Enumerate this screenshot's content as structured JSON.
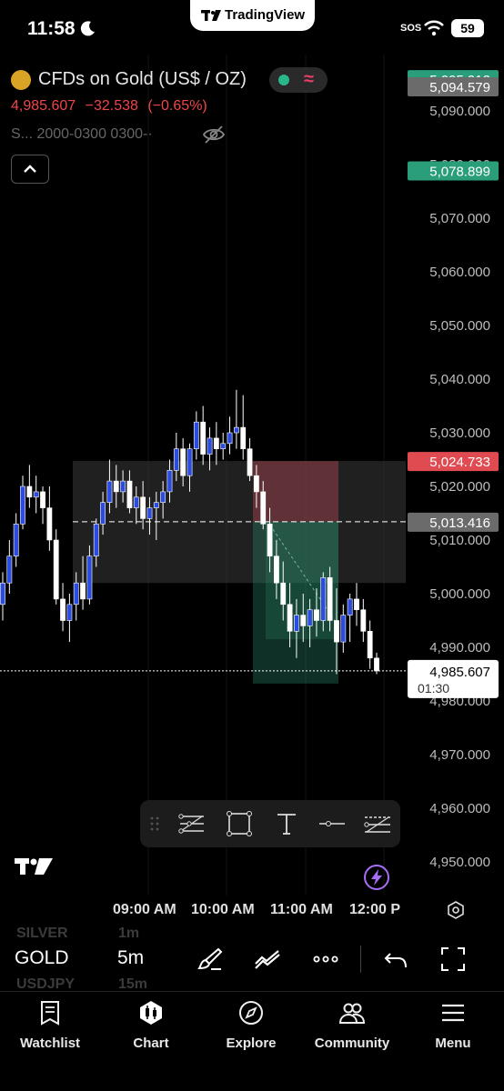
{
  "status_bar": {
    "time": "11:58",
    "sos": "SOS",
    "battery": "59"
  },
  "app": {
    "brand": "TradingView"
  },
  "symbol": {
    "title": "CFDs on Gold (US$ / OZ)",
    "price": "4,985.607",
    "change": "−32.538",
    "change_pct": "(−0.65%)",
    "session": "S... 2000-0300 0300-·"
  },
  "price_axis": {
    "ticks": [
      "5,090.000",
      "5,080.000",
      "5,070.000",
      "5,060.000",
      "5,050.000",
      "5,040.000",
      "5,030.000",
      "5,020.000",
      "5,010.000",
      "5,000.000",
      "4,990.000",
      "4,980.000",
      "4,970.000",
      "4,960.000",
      "4,950.000"
    ],
    "tags": [
      {
        "label": "5,095.912",
        "value": 5095.912,
        "color": "#2a9d7a"
      },
      {
        "label": "5,094.579",
        "value": 5094.579,
        "color": "#6b6b6b"
      },
      {
        "label": "5,078.899",
        "value": 5078.899,
        "color": "#2a9d7a"
      },
      {
        "label": "5,024.733",
        "value": 5024.733,
        "color": "#e04b52"
      },
      {
        "label": "5,013.416",
        "value": 5013.416,
        "color": "#6b6b6b"
      },
      {
        "label": "4,983.582",
        "value": 4983.582,
        "color": "#2a9d7a"
      }
    ],
    "last_price": "4,985.607",
    "countdown": "01:30"
  },
  "time_axis": {
    "labels": [
      "09:00 AM",
      "10:00 AM",
      "11:00 AM",
      "12:00 P"
    ]
  },
  "chart_data": {
    "type": "candlestick",
    "interval": "5m",
    "ylim": [
      4945,
      5100
    ],
    "colors": {
      "up": "#2b4ce0",
      "down": "#ffffff",
      "position_stop": "#b04a55",
      "position_target": "#2a8a6c"
    },
    "candles": [
      {
        "o": 4998.0,
        "h": 5004.0,
        "l": 4995.0,
        "c": 5002.0
      },
      {
        "o": 5002.0,
        "h": 5010.0,
        "l": 5000.0,
        "c": 5007.0
      },
      {
        "o": 5007.0,
        "h": 5015.0,
        "l": 5005.0,
        "c": 5013.0
      },
      {
        "o": 5013.0,
        "h": 5022.0,
        "l": 5012.0,
        "c": 5020.0
      },
      {
        "o": 5020.0,
        "h": 5024.0,
        "l": 5016.0,
        "c": 5018.0
      },
      {
        "o": 5018.0,
        "h": 5022.0,
        "l": 5015.0,
        "c": 5019.0
      },
      {
        "o": 5019.0,
        "h": 5020.0,
        "l": 5013.0,
        "c": 5016.0
      },
      {
        "o": 5016.0,
        "h": 5020.0,
        "l": 5008.0,
        "c": 5010.0
      },
      {
        "o": 5010.0,
        "h": 5012.0,
        "l": 4998.0,
        "c": 4999.0
      },
      {
        "o": 4999.0,
        "h": 5002.0,
        "l": 4993.0,
        "c": 4995.0
      },
      {
        "o": 4995.0,
        "h": 5000.0,
        "l": 4991.0,
        "c": 4998.0
      },
      {
        "o": 4998.0,
        "h": 5004.0,
        "l": 4995.0,
        "c": 5002.0
      },
      {
        "o": 5002.0,
        "h": 5007.0,
        "l": 4997.0,
        "c": 4999.0
      },
      {
        "o": 4999.0,
        "h": 5009.0,
        "l": 4998.0,
        "c": 5007.0
      },
      {
        "o": 5007.0,
        "h": 5014.0,
        "l": 5005.0,
        "c": 5013.0
      },
      {
        "o": 5013.0,
        "h": 5019.0,
        "l": 5011.0,
        "c": 5017.0
      },
      {
        "o": 5017.0,
        "h": 5025.0,
        "l": 5015.0,
        "c": 5021.0
      },
      {
        "o": 5021.0,
        "h": 5024.0,
        "l": 5016.0,
        "c": 5019.0
      },
      {
        "o": 5019.0,
        "h": 5023.0,
        "l": 5017.0,
        "c": 5021.0
      },
      {
        "o": 5021.0,
        "h": 5023.0,
        "l": 5015.0,
        "c": 5016.0
      },
      {
        "o": 5016.0,
        "h": 5020.0,
        "l": 5013.0,
        "c": 5018.0
      },
      {
        "o": 5018.0,
        "h": 5021.0,
        "l": 5012.0,
        "c": 5014.0
      },
      {
        "o": 5014.0,
        "h": 5018.0,
        "l": 5011.0,
        "c": 5016.0
      },
      {
        "o": 5016.0,
        "h": 5019.0,
        "l": 5010.0,
        "c": 5017.0
      },
      {
        "o": 5017.0,
        "h": 5021.0,
        "l": 5014.0,
        "c": 5019.0
      },
      {
        "o": 5019.0,
        "h": 5025.0,
        "l": 5017.0,
        "c": 5023.0
      },
      {
        "o": 5023.0,
        "h": 5030.0,
        "l": 5021.0,
        "c": 5027.0
      },
      {
        "o": 5027.0,
        "h": 5029.0,
        "l": 5020.0,
        "c": 5022.0
      },
      {
        "o": 5022.0,
        "h": 5028.0,
        "l": 5019.0,
        "c": 5027.0
      },
      {
        "o": 5027.0,
        "h": 5034.0,
        "l": 5025.0,
        "c": 5032.0
      },
      {
        "o": 5032.0,
        "h": 5035.0,
        "l": 5024.0,
        "c": 5026.0
      },
      {
        "o": 5026.0,
        "h": 5031.0,
        "l": 5023.0,
        "c": 5029.0
      },
      {
        "o": 5029.0,
        "h": 5032.0,
        "l": 5024.0,
        "c": 5027.0
      },
      {
        "o": 5027.0,
        "h": 5030.0,
        "l": 5025.0,
        "c": 5028.0
      },
      {
        "o": 5028.0,
        "h": 5033.0,
        "l": 5026.0,
        "c": 5030.0
      },
      {
        "o": 5030.0,
        "h": 5038.0,
        "l": 5027.0,
        "c": 5031.0
      },
      {
        "o": 5031.0,
        "h": 5037.0,
        "l": 5025.0,
        "c": 5027.0
      },
      {
        "o": 5027.0,
        "h": 5029.0,
        "l": 5021.0,
        "c": 5022.0
      },
      {
        "o": 5022.0,
        "h": 5024.0,
        "l": 5016.0,
        "c": 5019.0
      },
      {
        "o": 5019.0,
        "h": 5021.0,
        "l": 5012.0,
        "c": 5013.0
      },
      {
        "o": 5013.0,
        "h": 5016.0,
        "l": 5004.0,
        "c": 5007.0
      },
      {
        "o": 5007.0,
        "h": 5010.0,
        "l": 4999.0,
        "c": 5002.0
      },
      {
        "o": 5002.0,
        "h": 5006.0,
        "l": 4995.0,
        "c": 4998.0
      },
      {
        "o": 4998.0,
        "h": 5002.0,
        "l": 4990.0,
        "c": 4993.0
      },
      {
        "o": 4993.0,
        "h": 4999.0,
        "l": 4988.0,
        "c": 4996.0
      },
      {
        "o": 4996.0,
        "h": 5000.0,
        "l": 4991.0,
        "c": 4994.0
      },
      {
        "o": 4994.0,
        "h": 4999.0,
        "l": 4990.0,
        "c": 4997.0
      },
      {
        "o": 4997.0,
        "h": 5001.0,
        "l": 4992.0,
        "c": 4995.0
      },
      {
        "o": 4995.0,
        "h": 5004.0,
        "l": 4993.0,
        "c": 5003.0
      },
      {
        "o": 5003.0,
        "h": 5005.0,
        "l": 4993.0,
        "c": 4995.0
      },
      {
        "o": 4995.0,
        "h": 5001.0,
        "l": 4985.0,
        "c": 4991.0
      },
      {
        "o": 4991.0,
        "h": 4998.0,
        "l": 4989.0,
        "c": 4996.0
      },
      {
        "o": 4996.0,
        "h": 5000.0,
        "l": 4991.0,
        "c": 4999.0
      },
      {
        "o": 4999.0,
        "h": 5002.0,
        "l": 4994.0,
        "c": 4997.0
      },
      {
        "o": 4997.0,
        "h": 4999.0,
        "l": 4991.0,
        "c": 4993.0
      },
      {
        "o": 4993.0,
        "h": 4995.0,
        "l": 4986.0,
        "c": 4988.0
      },
      {
        "o": 4988.0,
        "h": 4989.0,
        "l": 4985.0,
        "c": 4985.6
      }
    ],
    "current_price": 4985.607,
    "position": {
      "entry": 5013.416,
      "stop": 5024.733,
      "target": 4983.582
    }
  },
  "symbol_bar": {
    "ghost_above": [
      "SILVER",
      "1m"
    ],
    "symbol": "GOLD",
    "interval": "5m",
    "ghost_below": [
      "USDJPY",
      "15m"
    ]
  },
  "tabs": [
    {
      "label": "Watchlist"
    },
    {
      "label": "Chart"
    },
    {
      "label": "Explore"
    },
    {
      "label": "Community"
    },
    {
      "label": "Menu"
    }
  ]
}
